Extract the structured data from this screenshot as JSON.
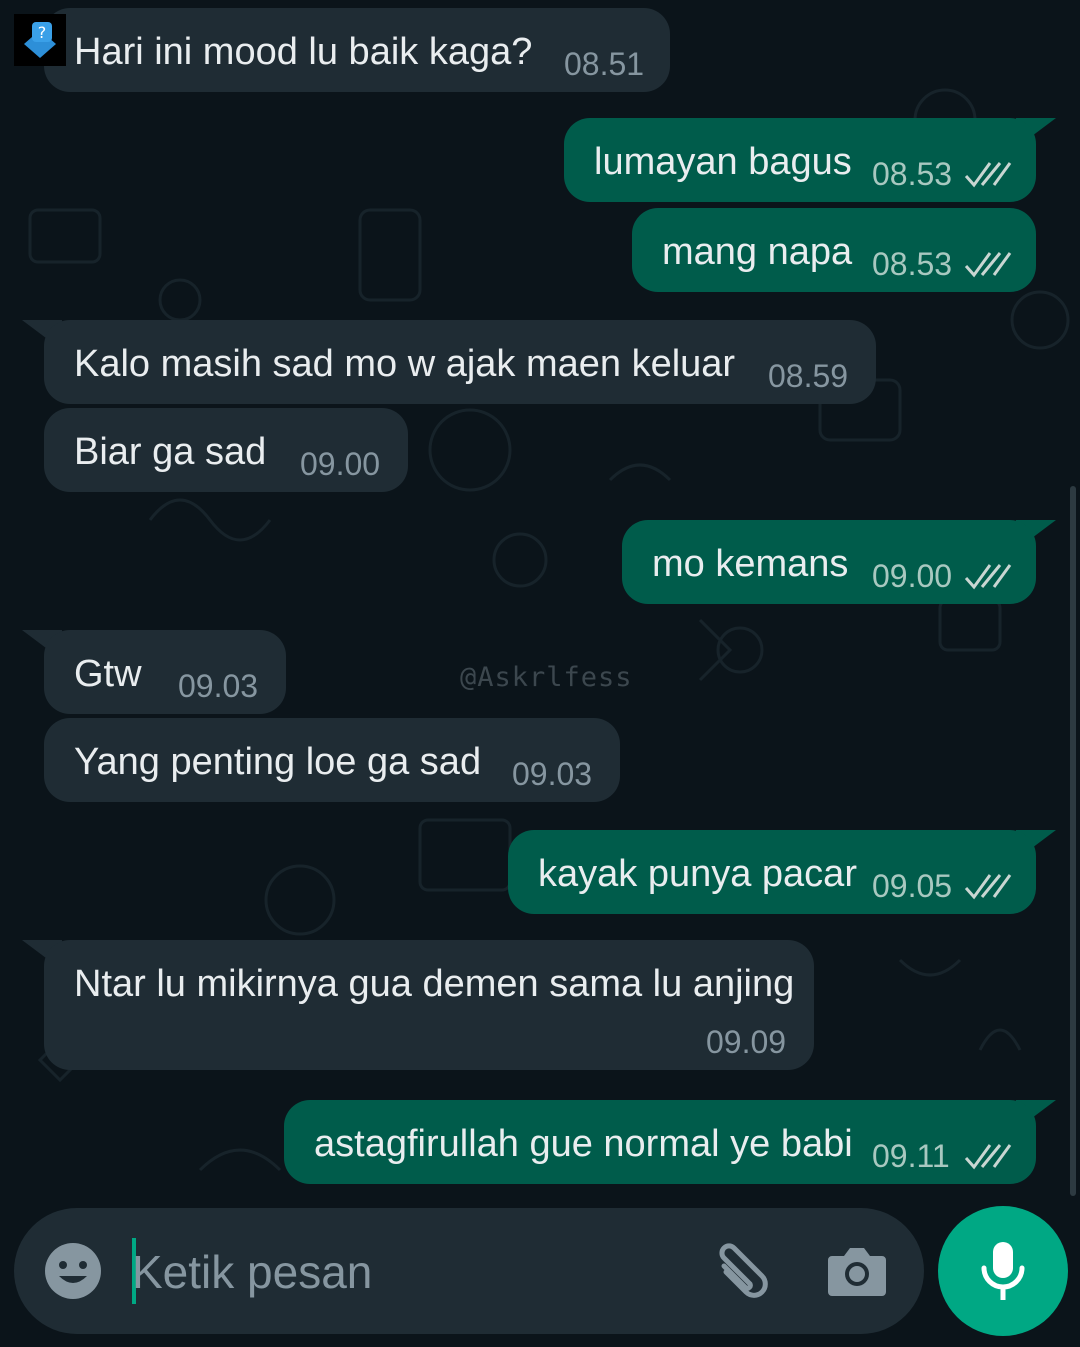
{
  "colors": {
    "background": "#0b141a",
    "incoming_bubble": "#1f2c34",
    "outgoing_bubble": "#005c4b",
    "accent": "#00a884",
    "text": "#e9edef",
    "meta_text": "#8696a0",
    "read_ticks": "#c9d6d2"
  },
  "watermark": "@Askrlfess",
  "messages": [
    {
      "text": "Hari ini mood lu baik kaga?",
      "time": "08.51",
      "direction": "incoming"
    },
    {
      "text": "lumayan bagus",
      "time": "08.53",
      "direction": "outgoing",
      "status_icon": "double-check-icon"
    },
    {
      "text": "mang napa",
      "time": "08.53",
      "direction": "outgoing",
      "status_icon": "double-check-icon"
    },
    {
      "text": "Kalo masih sad mo w ajak maen keluar",
      "time": "08.59",
      "direction": "incoming"
    },
    {
      "text": "Biar ga sad",
      "time": "09.00",
      "direction": "incoming"
    },
    {
      "text": "mo kemans",
      "time": "09.00",
      "direction": "outgoing",
      "status_icon": "double-check-icon"
    },
    {
      "text": "Gtw",
      "time": "09.03",
      "direction": "incoming"
    },
    {
      "text": "Yang penting loe ga sad",
      "time": "09.03",
      "direction": "incoming"
    },
    {
      "text": "kayak punya pacar",
      "time": "09.05",
      "direction": "outgoing",
      "status_icon": "double-check-icon"
    },
    {
      "text": "Ntar lu mikirnya gua demen sama lu anjing",
      "time": "09.09",
      "direction": "incoming"
    },
    {
      "text": "astagfirullah gue normal ye babi",
      "time": "09.11",
      "direction": "outgoing",
      "status_icon": "double-check-icon"
    }
  ],
  "composer": {
    "placeholder": "Ketik pesan",
    "value": "",
    "emoji_icon": "smiley-icon",
    "attach_icon": "paperclip-icon",
    "camera_icon": "camera-icon",
    "send_icon": "microphone-icon"
  }
}
